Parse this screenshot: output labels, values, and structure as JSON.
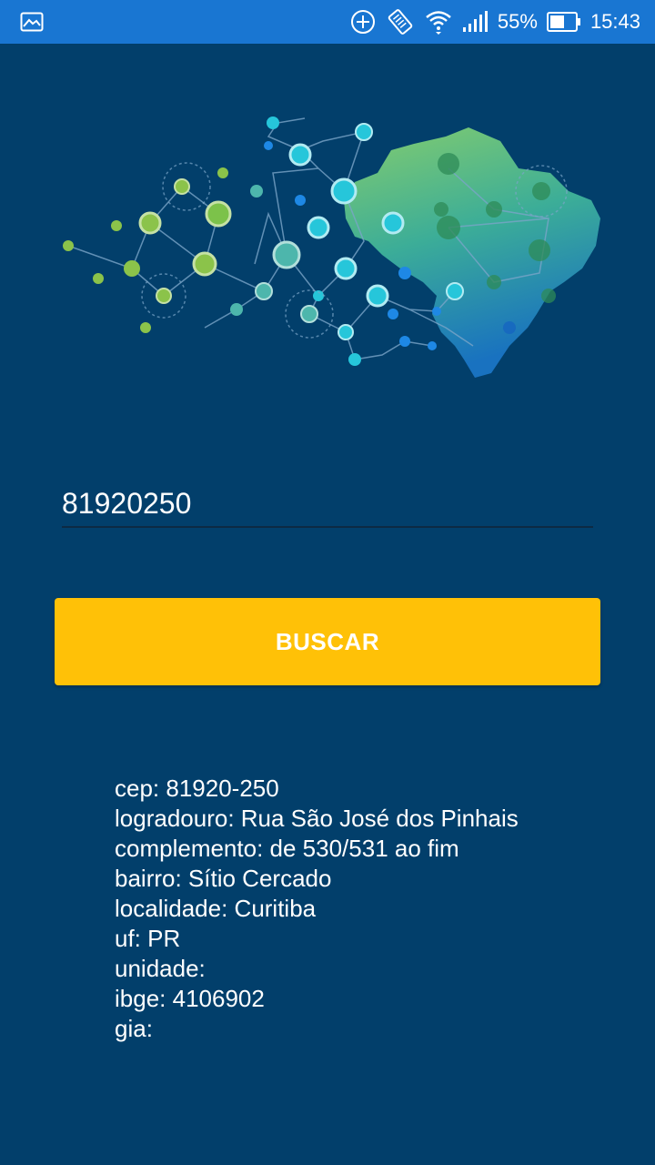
{
  "status_bar": {
    "battery_percent": "55%",
    "time": "15:43",
    "icons": [
      "image-icon",
      "data-saver-icon",
      "auto-rotate-icon",
      "wifi-icon",
      "signal-icon",
      "battery-icon"
    ]
  },
  "hero": {
    "icon": "brazil-network-illustration",
    "colors": {
      "green": "#8bc34a",
      "teal": "#26c6da",
      "blue": "#1e88e5",
      "map_top": "#8bd46e",
      "map_bottom": "#1a75c4"
    }
  },
  "form": {
    "cep_value": "81920250",
    "search_label": "BUSCAR",
    "button_color": "#ffc107"
  },
  "result": {
    "lines": [
      "cep: 81920-250",
      "logradouro: Rua São José dos Pinhais",
      "complemento: de 530/531 ao fim",
      "bairro: Sítio Cercado",
      "localidade: Curitiba",
      "uf: PR",
      "unidade:",
      "ibge: 4106902",
      "gia:"
    ]
  },
  "theme": {
    "background": "#023f6b",
    "status_bar": "#1976d2"
  }
}
